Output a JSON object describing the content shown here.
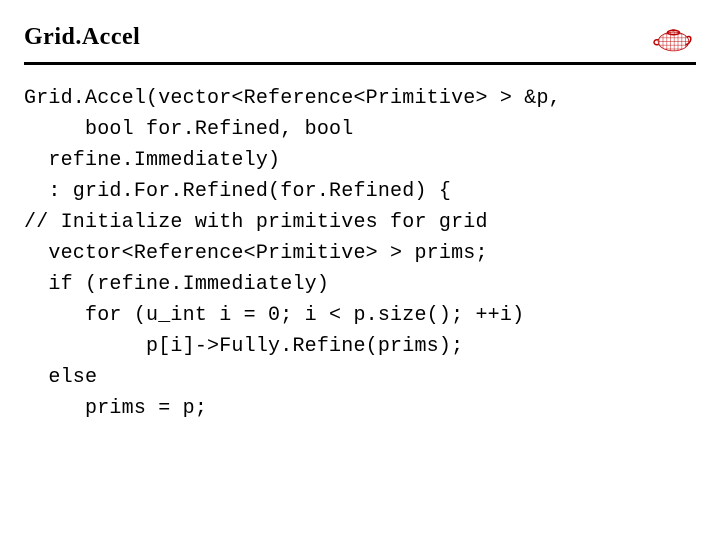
{
  "title": "Grid.Accel",
  "code": {
    "l1": "Grid.Accel(vector<Reference<Primitive> > &p,",
    "l2": "     bool for.Refined, bool",
    "l3": "  refine.Immediately)",
    "l4": "  : grid.For.Refined(for.Refined) {",
    "l5": "// Initialize with primitives for grid",
    "l6": "  vector<Reference<Primitive> > prims;",
    "l7": "  if (refine.Immediately)",
    "l8": "     for (u_int i = 0; i < p.size(); ++i)",
    "l9": "          p[i]->Fully.Refine(prims);",
    "l10": "  else",
    "l11": "     prims = p;"
  }
}
